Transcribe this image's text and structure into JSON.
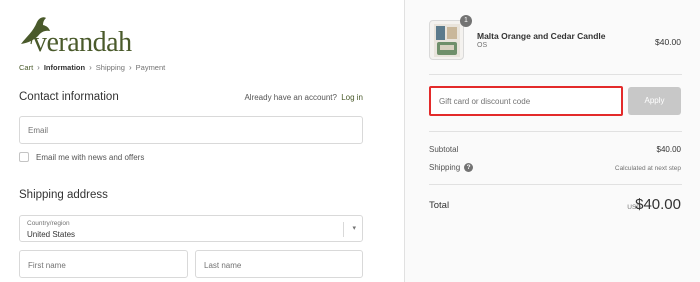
{
  "brand": {
    "logo_text": "verandah",
    "logo_color": "#4a5a2b"
  },
  "breadcrumb": {
    "items": [
      "Cart",
      "Information",
      "Shipping",
      "Payment"
    ],
    "current_index": 1
  },
  "contact": {
    "title": "Contact information",
    "login_prompt": "Already have an account?",
    "login_link": "Log in",
    "email_placeholder": "Email",
    "newsletter_label": "Email me with news and offers"
  },
  "shipping": {
    "title": "Shipping address",
    "country_label": "Country/region",
    "country_value": "United States",
    "first_name_placeholder": "First name",
    "last_name_placeholder": "Last name"
  },
  "order": {
    "item": {
      "name": "Malta Orange and Cedar Candle",
      "variant": "OS",
      "price": "$40.00",
      "quantity": "1"
    },
    "discount_placeholder": "Gift card or discount code",
    "apply_label": "Apply",
    "subtotal_label": "Subtotal",
    "subtotal_value": "$40.00",
    "shipping_label": "Shipping",
    "shipping_value": "Calculated at next step",
    "total_label": "Total",
    "total_currency": "USD",
    "total_value": "$40.00"
  },
  "colors": {
    "accent": "#4a5a2b",
    "highlight": "#e32a2a",
    "apply_disabled": "#c8c8c8"
  }
}
